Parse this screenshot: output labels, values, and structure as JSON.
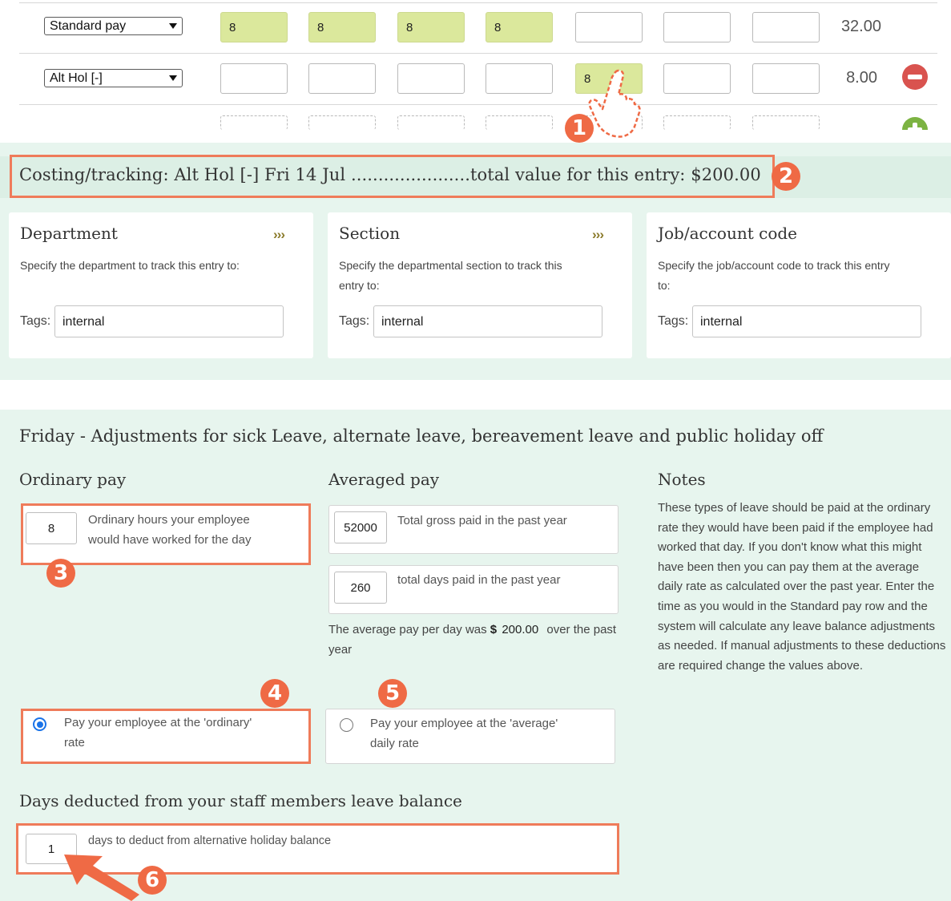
{
  "timesheet": {
    "rows": [
      {
        "pay_type": "Standard pay",
        "hours": [
          "8",
          "8",
          "8",
          "8",
          "",
          "",
          ""
        ],
        "total": "32.00"
      },
      {
        "pay_type": "Alt Hol [-]",
        "hours": [
          "",
          "",
          "",
          "",
          "8",
          "",
          ""
        ],
        "total": "8.00"
      }
    ],
    "remove_icon": "minus-circle-icon",
    "add_icon": "plus-circle-icon"
  },
  "costing": {
    "title": "Costing/tracking: Alt Hol [-] Fri 14 Jul ......................total value for this entry: $200.00",
    "cards": [
      {
        "title": "Department",
        "arrows": "›››",
        "desc": "Specify the department to track this entry to:",
        "tags_label": "Tags:",
        "tags_value": "internal"
      },
      {
        "title": "Section",
        "arrows": "›››",
        "desc": "Specify the departmental section to track this entry to:",
        "tags_label": "Tags:",
        "tags_value": "internal"
      },
      {
        "title": "Job/account code",
        "arrows": "",
        "desc": "Specify the job/account code to track this entry to:",
        "tags_label": "Tags:",
        "tags_value": "internal"
      }
    ]
  },
  "adjustments": {
    "heading": "Friday - Adjustments for sick Leave, alternate leave, bereavement leave and public holiday off",
    "ordinary": {
      "title": "Ordinary pay",
      "hours_value": "8",
      "hours_label": "Ordinary hours your employee would have worked for the day"
    },
    "averaged": {
      "title": "Averaged pay",
      "gross_value": "52000",
      "gross_label": "Total gross paid in the past year",
      "days_value": "260",
      "days_label": "total days paid in the past year",
      "avg_prefix": "The average pay per day was",
      "avg_currency": "$",
      "avg_value": "200.00",
      "avg_suffix": "over the past year"
    },
    "notes": {
      "title": "Notes",
      "text": "These types of leave should be paid at the ordinary rate they would have been paid if the employee had worked that day. If you don't know what this might have been then you can pay them at the average daily rate as calculated over the past year. Enter the time as you would in the Standard pay row and the system will calculate any leave balance adjustments as needed. If manual adjustments to these deductions are required change the values above."
    },
    "rate_options": [
      {
        "label": "Pay your employee at the 'ordinary' rate",
        "selected": true
      },
      {
        "label": "Pay your employee at the 'average' daily rate",
        "selected": false
      }
    ],
    "deduct": {
      "title": "Days deducted from your staff members leave balance",
      "value": "1",
      "label": "days to deduct from alternative holiday balance"
    }
  },
  "annotations": {
    "badges": [
      "1",
      "2",
      "3",
      "4",
      "5",
      "6"
    ],
    "accent_color": "#ef6a45",
    "pointer_icon": "hand-pointer-icon",
    "arrow_icon": "arrow-icon"
  },
  "colors": {
    "section_bg": "#e7f5ee",
    "filled_hours": "#dbe89c",
    "remove": "#d9534f",
    "add": "#7cb342",
    "radio": "#1a73e8"
  }
}
